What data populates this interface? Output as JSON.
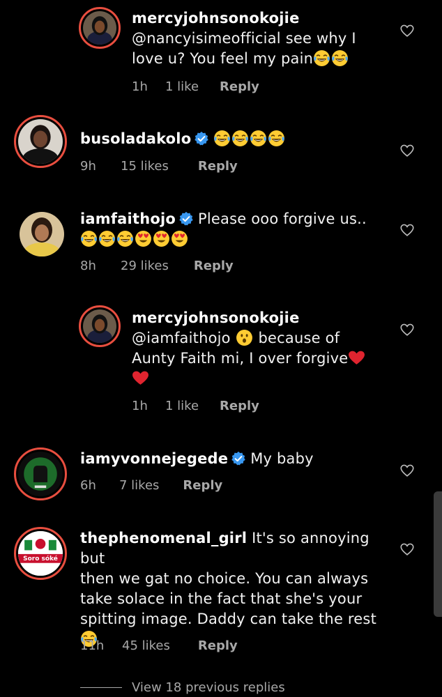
{
  "comments": [
    {
      "username": "mercyjohnsonokojie",
      "mention": "@nancyisimeofficial",
      "text_before": "  see why I",
      "text_line2": "love u? You feel my pain",
      "emojis_line2": [
        "laughing-tears",
        "laughing-tears"
      ],
      "time": "1h",
      "likes": "1 like",
      "reply": "Reply"
    },
    {
      "username": "busoladakolo",
      "verified": true,
      "emojis": [
        "laughing-tears",
        "laughing-tears",
        "laughing-tears",
        "laughing-tears"
      ],
      "time": "9h",
      "likes": "15 likes",
      "reply": "Reply"
    },
    {
      "username": "iamfaithojo",
      "verified": true,
      "text": "Please ooo forgive us..",
      "emojis_line2": [
        "laughing-tears",
        "laughing-tears",
        "laughing-tears",
        "heart-eyes",
        "heart-eyes",
        "heart-eyes"
      ],
      "time": "8h",
      "likes": "29 likes",
      "reply": "Reply"
    },
    {
      "username": "mercyjohnsonokojie",
      "mention": "@iamfaithojo",
      "text_after": "because of",
      "text_line2": "Aunty Faith mi, I over forgive",
      "emoji_inline": "surprised",
      "time": "1h",
      "likes": "1 like",
      "reply": "Reply"
    },
    {
      "username": "iamyvonnejegede",
      "verified": true,
      "text": "My baby",
      "time": "6h",
      "likes": "7 likes",
      "reply": "Reply"
    },
    {
      "username": "thephenomenal_girl",
      "text_line1": "It's so annoying but",
      "text_line2": "then we gat no choice. You can always",
      "text_line3": "take solace in the fact that she's your",
      "text_line4": "spitting image. Daddy can take the rest",
      "emoji_line5": "laughing-tears",
      "avatar_text": "Soro sóké",
      "time": "11h",
      "likes": "45 likes",
      "reply": "Reply"
    }
  ],
  "view_replies": "View 18 previous replies",
  "colors": {
    "background": "#000000",
    "text": "#f2f2f2",
    "meta": "#a8a8a8",
    "story_ring": "#e84e3f",
    "verified": "#3897f0",
    "red_heart": "#e0242f"
  }
}
